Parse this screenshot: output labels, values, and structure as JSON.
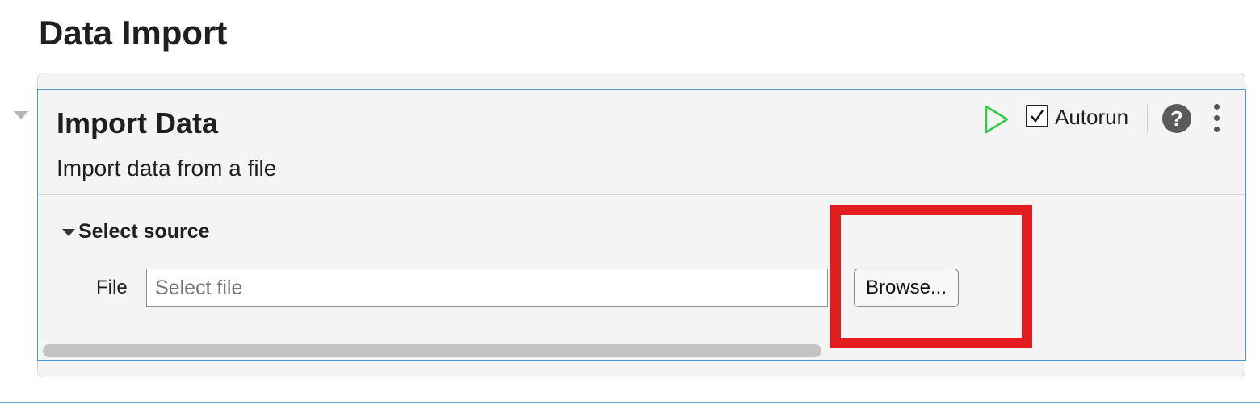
{
  "page": {
    "title": "Data Import"
  },
  "card": {
    "title": "Import Data",
    "description": "Import data from a file",
    "toolbar": {
      "run_icon": "play-icon",
      "autorun_label": "Autorun",
      "autorun_checked": true,
      "help_symbol": "?",
      "more_icon": "more-vertical-icon"
    },
    "section": {
      "title": "Select source",
      "expanded": true,
      "file_label": "File",
      "file_placeholder": "Select file",
      "file_value": "",
      "browse_label": "Browse..."
    }
  },
  "colors": {
    "run_icon": "#2ecc40",
    "highlight": "#e31d1f",
    "card_border": "#4f9bd8",
    "panel_bg": "#f4f4f4"
  }
}
